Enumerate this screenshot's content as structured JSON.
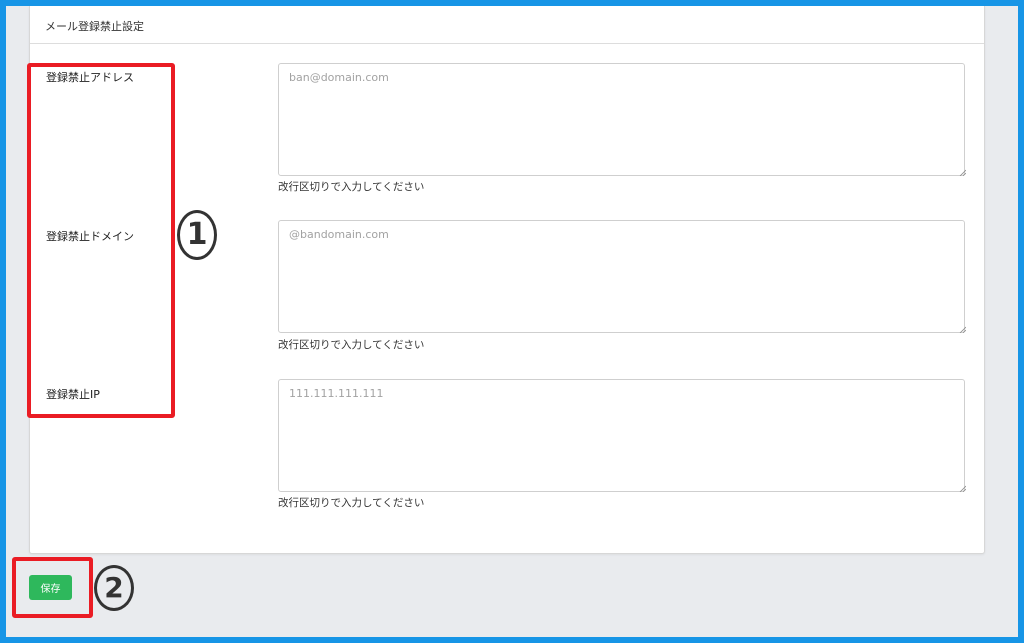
{
  "card": {
    "title": "メール登録禁止設定"
  },
  "fields": [
    {
      "label": "登録禁止アドレス",
      "placeholder": "ban@domain.com",
      "value": "",
      "help": "改行区切りで入力してください"
    },
    {
      "label": "登録禁止ドメイン",
      "placeholder": "@bandomain.com",
      "value": "",
      "help": "改行区切りで入力してください"
    },
    {
      "label": "登録禁止IP",
      "placeholder": "111.111.111.111",
      "value": "",
      "help": "改行区切りで入力してください"
    }
  ],
  "actions": {
    "save_label": "保存"
  },
  "annotations": {
    "callout_1": "1",
    "callout_2": "2",
    "highlight_color": "#ea1c24"
  },
  "colors": {
    "frame_border": "#1795e6",
    "background": "#e9ebee",
    "save_button": "#2eb85c"
  }
}
